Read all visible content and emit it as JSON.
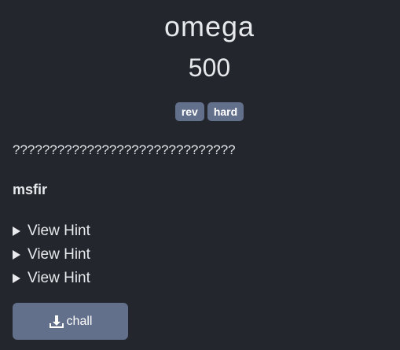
{
  "challenge": {
    "name": "omega",
    "value": "500",
    "tags": [
      "rev",
      "hard"
    ],
    "description": "??????????????????????????????",
    "author": "msfir"
  },
  "hints": [
    {
      "label": "View Hint"
    },
    {
      "label": "View Hint"
    },
    {
      "label": "View Hint"
    }
  ],
  "download": {
    "label": "chall",
    "icon": "download-icon"
  },
  "colors": {
    "background": "#23262c",
    "accent": "#63708c",
    "text": "#e2e4e8"
  }
}
